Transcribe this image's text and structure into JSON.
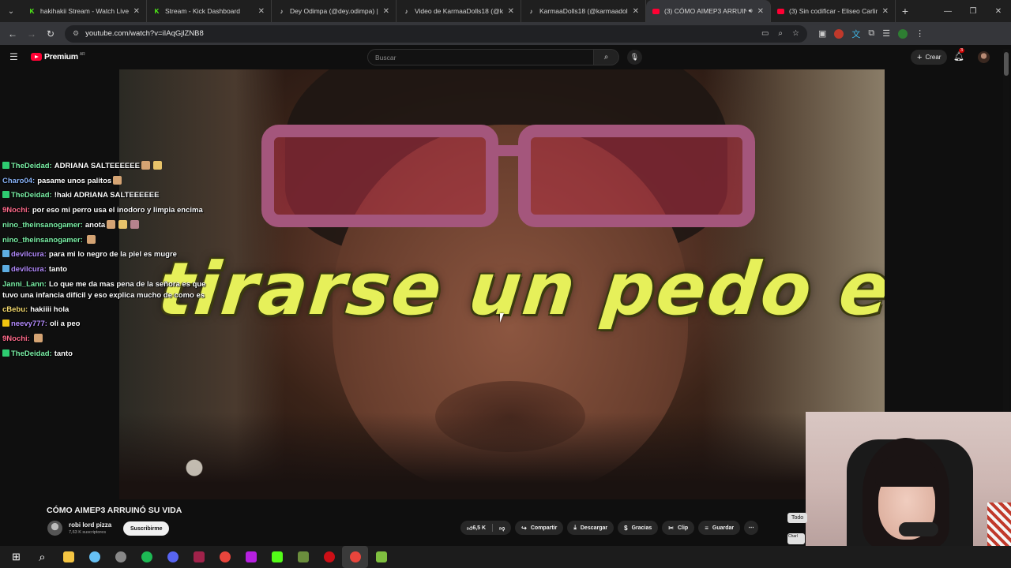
{
  "browser": {
    "tabs": [
      {
        "title": "hakihakii Stream - Watch Live o",
        "favicon": "kick-icon",
        "color": "#53fc18",
        "active": false
      },
      {
        "title": "Stream - Kick Dashboard",
        "favicon": "kick-icon",
        "color": "#53fc18",
        "active": false
      },
      {
        "title": "Dey Odimpa (@dey.odimpa) | Ti",
        "favicon": "tiktok-icon",
        "color": "#ffffff",
        "active": false
      },
      {
        "title": "Video de KarmaaDolls18 (@karm",
        "favicon": "tiktok-icon",
        "color": "#ffffff",
        "active": false
      },
      {
        "title": "KarmaaDolls18 (@karmaadolls",
        "favicon": "tiktok-icon",
        "color": "#ffffff",
        "active": false
      },
      {
        "title": "(3) CÓMO AIMEP3 ARRUIN",
        "favicon": "youtube-icon",
        "color": "#ff0033",
        "active": true
      },
      {
        "title": "(3) Sin codificar - Eliseo Carling",
        "favicon": "youtube-icon",
        "color": "#ff0033",
        "active": false
      }
    ],
    "url": "youtube.com/watch?v=iIAqGjlZNB8"
  },
  "youtube": {
    "logo_text": "Premium",
    "region": "AR",
    "search_placeholder": "Buscar",
    "create_label": "Crear",
    "notif_count": "3"
  },
  "video": {
    "caption": "tirarse un pedo en TV",
    "title": "CÓMO AIMEP3 ARRUINÓ SU VIDA",
    "channel": "robi lord pizza",
    "subscribers": "7,63 K suscriptores",
    "subscribe_label": "Suscribirme",
    "likes": "6,5 K",
    "actions": {
      "share": "Compartir",
      "download": "Descargar",
      "thanks": "Gracias",
      "clip": "Clip",
      "save": "Guardar"
    }
  },
  "chat": [
    {
      "user": "TheDeidad",
      "color": "#7cf2a8",
      "badge": "#2ecc71",
      "text": "ADRIANA SALTEEEEEE",
      "emotes": 2
    },
    {
      "user": "Charo04",
      "color": "#8ab4f8",
      "badge": "",
      "text": "pasame unos palitos",
      "emotes": 1
    },
    {
      "user": "TheDeidad",
      "color": "#7cf2a8",
      "badge": "#2ecc71",
      "text": "!haki ADRIANA SALTEEEEEE",
      "emotes": 0
    },
    {
      "user": "9Nochi",
      "color": "#ff6b8b",
      "badge": "",
      "text": "por eso mi perro usa el inodoro y limpia encima",
      "emotes": 0
    },
    {
      "user": "nino_theinsanogamer",
      "color": "#7cf2a8",
      "badge": "",
      "text": "anota",
      "emotes": 3
    },
    {
      "user": "nino_theinsanogamer",
      "color": "#7cf2a8",
      "badge": "",
      "text": "",
      "emotes": 1
    },
    {
      "user": "devilcura",
      "color": "#b58cff",
      "badge": "#5dade2",
      "text": "para mi lo negro de la piel es mugre",
      "emotes": 0
    },
    {
      "user": "devilcura",
      "color": "#b58cff",
      "badge": "#5dade2",
      "text": "tanto",
      "emotes": 0
    },
    {
      "user": "Janni_Lann",
      "color": "#7cf2a8",
      "badge": "",
      "text": "Lo que me da mas pena de la señora es que tuvo una infancia difícil y eso explica mucho de como es",
      "emotes": 0,
      "wrap": true
    },
    {
      "user": "cBebu",
      "color": "#f7dc6f",
      "badge": "",
      "text": "hakiiii hola",
      "emotes": 0
    },
    {
      "user": "neevy777",
      "color": "#b58cff",
      "badge": "#f1c40f",
      "text": "oli a peo",
      "emotes": 0
    },
    {
      "user": "9Nochi",
      "color": "#ff6b8b",
      "badge": "",
      "text": "",
      "emotes": 1
    },
    {
      "user": "TheDeidad",
      "color": "#7cf2a8",
      "badge": "#2ecc71",
      "text": "tanto",
      "emotes": 0
    }
  ],
  "webcam": {
    "todo_label": "Todo",
    "chip_label": "Charl"
  },
  "taskbar": [
    {
      "name": "windows-start-icon",
      "color": "#ffffff"
    },
    {
      "name": "search-icon",
      "color": "#ffffff"
    },
    {
      "name": "file-explorer-icon",
      "color": "#f4c542"
    },
    {
      "name": "steam-icon",
      "color": "#66c0f4"
    },
    {
      "name": "obs-icon",
      "color": "#888888"
    },
    {
      "name": "spotify-icon",
      "color": "#1db954"
    },
    {
      "name": "discord-icon",
      "color": "#5865f2"
    },
    {
      "name": "app-icon",
      "color": "#a0224a"
    },
    {
      "name": "chrome-icon",
      "color": "#e8453c"
    },
    {
      "name": "canva-icon",
      "color": "#b620e0"
    },
    {
      "name": "kick-icon",
      "color": "#53fc18"
    },
    {
      "name": "minecraft-icon",
      "color": "#6b8e3d"
    },
    {
      "name": "opera-icon",
      "color": "#cc0f16"
    },
    {
      "name": "chrome-active-icon",
      "color": "#e8453c"
    },
    {
      "name": "minecraft-alt-icon",
      "color": "#7fbf3f"
    }
  ]
}
